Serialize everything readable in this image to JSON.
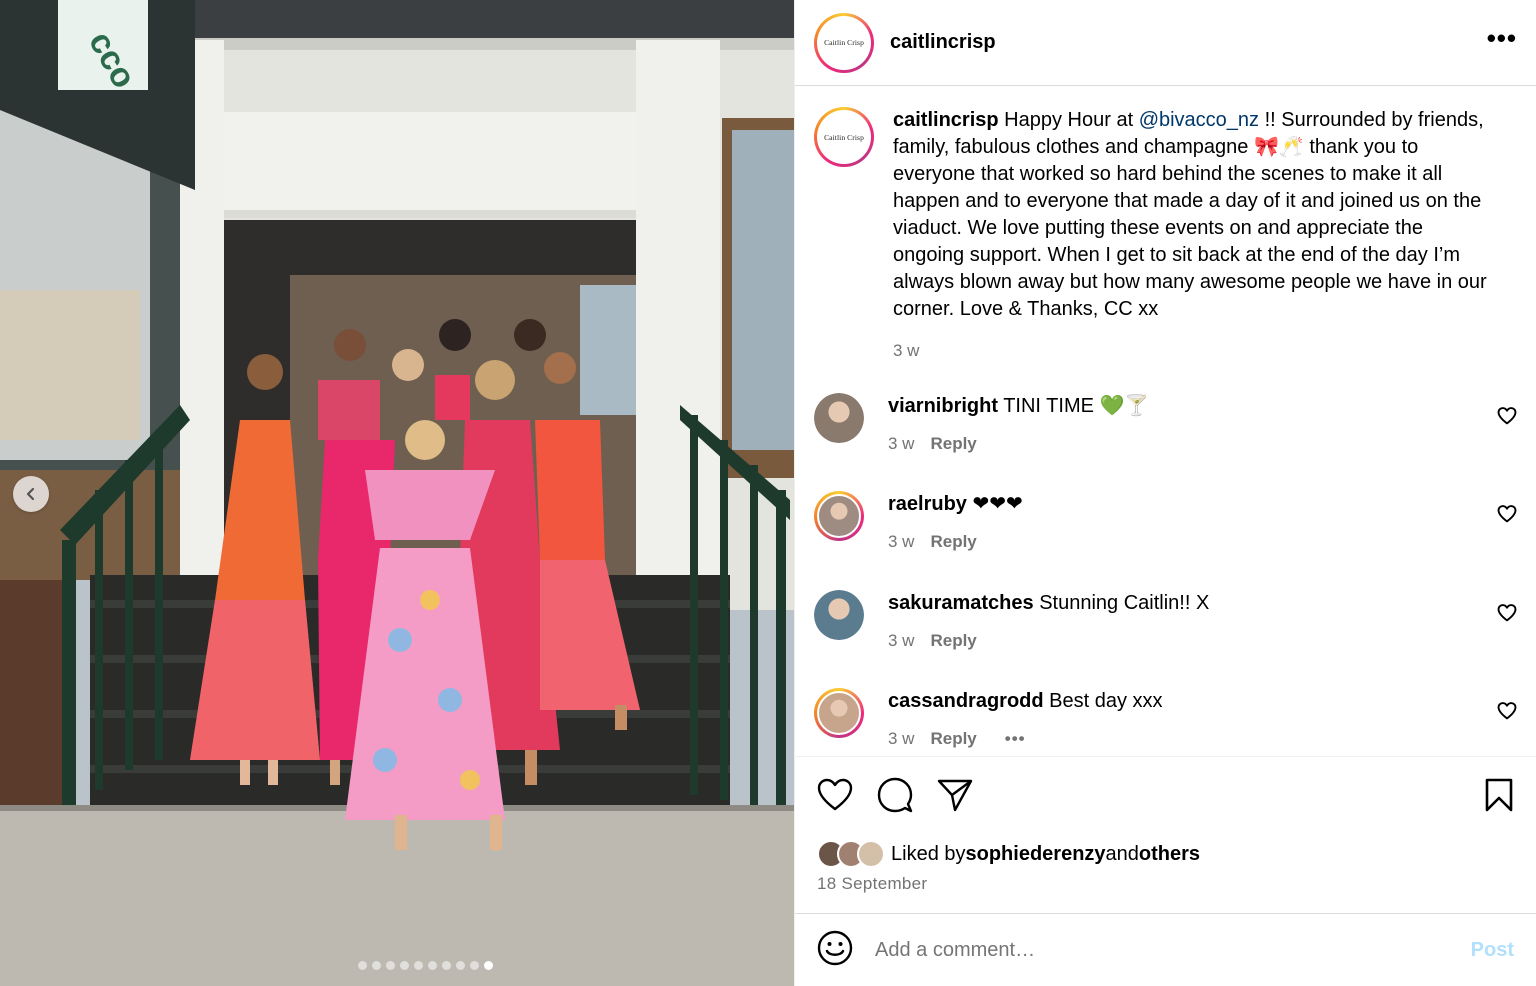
{
  "photo": {
    "sign_text": "cco",
    "carousel_total": 10,
    "carousel_active": 10
  },
  "post": {
    "author": "caitlincrisp",
    "avatar_text": "Caitlin Crisp",
    "more_label": "•••",
    "caption": {
      "username": "caitlincrisp",
      "pre": " Happy Hour at ",
      "mention": "@bivacco_nz",
      "post": " !! Surrounded by friends, family, fabulous clothes and champagne 🎀🥂 thank you to everyone that worked so hard behind the scenes to make it all happen and to everyone that made a day of it and joined us on the viaduct. We love putting these events on and appreciate the ongoing support. When I get to sit back at the end of the day I’m always blown away but how many awesome people we have in our corner. Love & Thanks, CC xx",
      "time": "3 w"
    },
    "comments": [
      {
        "user": "viarnibright",
        "text": " TINI TIME 💚🍸",
        "time": "3 w",
        "reply": "Reply",
        "avatar_color": "#8a7a6e",
        "ringed": false
      },
      {
        "user": "raelruby",
        "text": " ❤❤❤",
        "time": "3 w",
        "reply": "Reply",
        "avatar_color": "#9e8b82",
        "ringed": true
      },
      {
        "user": "sakuramatches",
        "text": " Stunning Caitlin!! X",
        "time": "3 w",
        "reply": "Reply",
        "avatar_color": "#5b7c8f",
        "ringed": false
      },
      {
        "user": "cassandragrodd",
        "text": " Best day xxx",
        "time": "3 w",
        "reply": "Reply",
        "avatar_color": "#c7a48c",
        "ringed": true,
        "more": "•••"
      }
    ],
    "likes": {
      "prefix": "Liked by ",
      "user": "sophiederenzy",
      "middle": " and ",
      "others": "others"
    },
    "date": "18 September",
    "add_comment": {
      "placeholder": "Add a comment…",
      "post_label": "Post"
    }
  },
  "colors": {
    "ring_start": "#f9ce34",
    "ring_mid": "#ee2a7b",
    "mention": "#00376b",
    "muted": "#737373",
    "post_disabled": "#b2dffc"
  },
  "icons": [
    "chevron-left-icon",
    "more-icon",
    "heart-icon",
    "comment-icon",
    "share-icon",
    "bookmark-icon",
    "emoji-icon"
  ]
}
